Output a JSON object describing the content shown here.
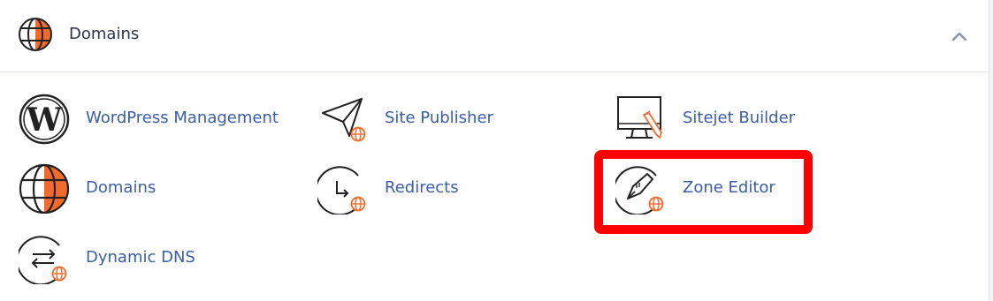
{
  "section": {
    "title": "Domains",
    "collapse_icon": "chevron-up-icon"
  },
  "items": [
    {
      "label": "WordPress Management",
      "icon": "wordpress-icon"
    },
    {
      "label": "Site Publisher",
      "icon": "site-publisher-icon"
    },
    {
      "label": "Sitejet Builder",
      "icon": "sitejet-builder-icon"
    },
    {
      "label": "Domains",
      "icon": "globe-icon"
    },
    {
      "label": "Redirects",
      "icon": "redirects-icon"
    },
    {
      "label": "Zone Editor",
      "icon": "zone-editor-icon"
    },
    {
      "label": "Dynamic DNS",
      "icon": "dynamic-dns-icon"
    }
  ],
  "colors": {
    "accent_orange": "#f26b2c",
    "link_blue": "#3a5da6",
    "highlight_red": "#ff0000"
  }
}
